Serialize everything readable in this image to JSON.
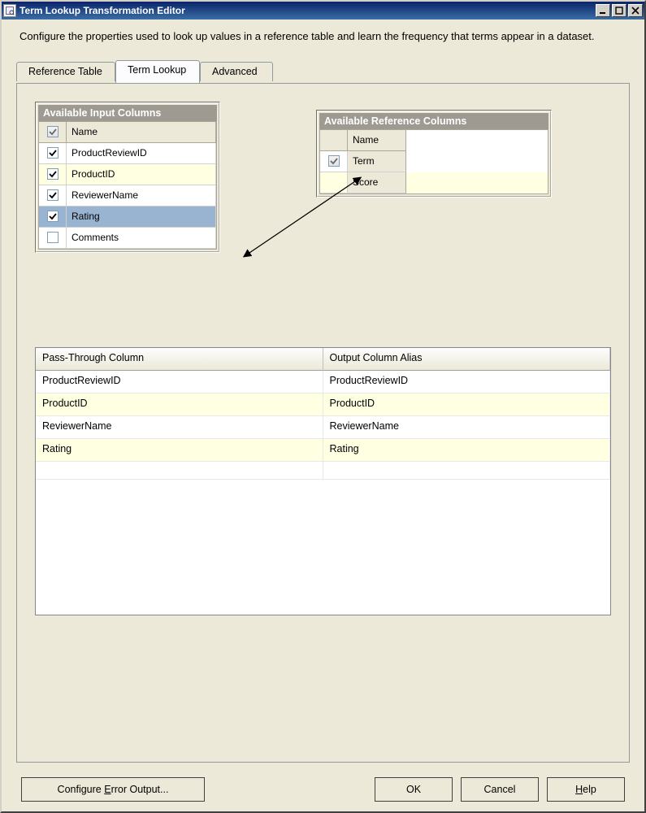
{
  "window": {
    "title": "Term Lookup Transformation Editor"
  },
  "description": "Configure the properties used to look up values in a reference table and learn the frequency that terms appear in a dataset.",
  "tabs": {
    "reference": "Reference Table",
    "lookup": "Term Lookup",
    "advanced": "Advanced"
  },
  "input_box": {
    "title": "Available Input Columns",
    "header_name": "Name",
    "rows": [
      {
        "checked": true,
        "name": "ProductReviewID",
        "selected": false
      },
      {
        "checked": true,
        "name": "ProductID",
        "selected": false
      },
      {
        "checked": true,
        "name": "ReviewerName",
        "selected": false
      },
      {
        "checked": true,
        "name": "Rating",
        "selected": true
      },
      {
        "checked": false,
        "name": "Comments",
        "selected": false
      }
    ]
  },
  "ref_box": {
    "title": "Available Reference Columns",
    "header_name": "Name",
    "rows": [
      {
        "checked": true,
        "name": "Term",
        "selected": false,
        "has_cb": true
      },
      {
        "checked": false,
        "name": "Score",
        "selected": false,
        "has_cb": false
      }
    ]
  },
  "out_table": {
    "headers": {
      "pass": "Pass-Through Column",
      "alias": "Output Column Alias"
    },
    "rows": [
      {
        "pass": "ProductReviewID",
        "alias": "ProductReviewID"
      },
      {
        "pass": "ProductID",
        "alias": "ProductID"
      },
      {
        "pass": "ReviewerName",
        "alias": "ReviewerName"
      },
      {
        "pass": "Rating",
        "alias": "Rating"
      }
    ]
  },
  "buttons": {
    "configure": "Configure Error Output...",
    "configure_hot": "E",
    "ok": "OK",
    "cancel": "Cancel",
    "help": "Help",
    "help_hot": "H"
  }
}
